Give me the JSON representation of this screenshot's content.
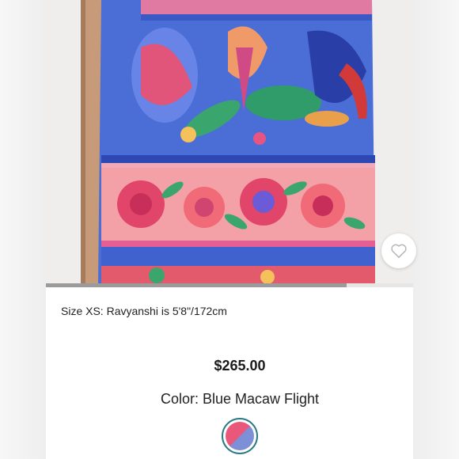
{
  "product": {
    "image_alt_icon": "dress-photo",
    "size_note": "Size XS: Ravyanshi is 5'8\"/172cm",
    "price": "$265.00",
    "color_label": "Color: Blue Macaw Flight",
    "favorite_icon": "heart-icon",
    "swatch": {
      "colors": [
        "#e9577a",
        "#7d8fd6"
      ],
      "ring_color": "#2b7a86"
    },
    "image_scroll_progress": 0.82
  }
}
